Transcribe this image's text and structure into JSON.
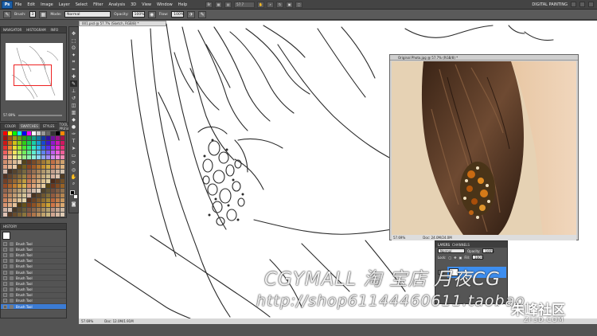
{
  "menubar": {
    "logo": "Ps",
    "items": [
      "File",
      "Edit",
      "Image",
      "Layer",
      "Select",
      "Filter",
      "Analysis",
      "3D",
      "View",
      "Window",
      "Help"
    ],
    "zoom": "57.7",
    "workspace": "DIGITAL PAINTING"
  },
  "options": {
    "brush_label": "Brush:",
    "brush_size": "3",
    "mode_label": "Mode:",
    "mode_value": "Normal",
    "opacity_label": "Opacity:",
    "opacity_value": "100%",
    "flow_label": "Flow:",
    "flow_value": "100%"
  },
  "navigator": {
    "tabs": [
      "NAVIGATOR",
      "HISTOGRAM",
      "INFO"
    ],
    "zoom": "57.69%"
  },
  "swatches": {
    "tabs": [
      "COLOR",
      "SWATCHES",
      "STYLES",
      "TOOL PRESETS"
    ]
  },
  "history": {
    "tab": "HISTORY",
    "items": [
      "Brush Tool",
      "Brush Tool",
      "Brush Tool",
      "Brush Tool",
      "Brush Tool",
      "Brush Tool",
      "Brush Tool",
      "Brush Tool",
      "Brush Tool",
      "Brush Tool",
      "Brush Tool",
      "Brush Tool",
      "Brush Tool",
      "Brush Tool",
      "Brush Tool",
      "Brush Tool",
      "Brush Tool",
      "Brush Tool",
      "Brush Tool",
      "Brush Tool",
      "Brush Tool",
      "Brush Tool",
      "Brush Tool",
      "Brush Tool",
      "Brush Tool",
      "Brush Tool"
    ]
  },
  "document": {
    "tab_title": "001.psd @ 57.7% (Sketch, RGB/8) *",
    "status_zoom": "57.69%",
    "status_doc": "Doc: 12.0M/1.91M"
  },
  "photo": {
    "title": "Original Photo.jpg @ 57.7% (RGB/8) *",
    "status_zoom": "57.69%",
    "status_doc": "Doc: 24.0M/24.0M"
  },
  "layers": {
    "tabs": [
      "LAYERS",
      "CHANNELS"
    ],
    "mode_value": "Normal",
    "opacity_label": "Opacity:",
    "opacity_value": "100%",
    "lock_label": "Lock:",
    "fill_label": "Fill:",
    "fill_value": "100%",
    "layer_name": "Sketch"
  },
  "watermark": {
    "line1": "CGYMALL 淘 宝店 月夜CG",
    "line2": "http://shop61144460611.taobao",
    "logo_cn": "朱峰社区",
    "logo_en": "ZF3D.COM"
  },
  "colors": {
    "accent": "#3d8ef0",
    "panel": "#545454",
    "nav_rect": "#ee2222"
  }
}
